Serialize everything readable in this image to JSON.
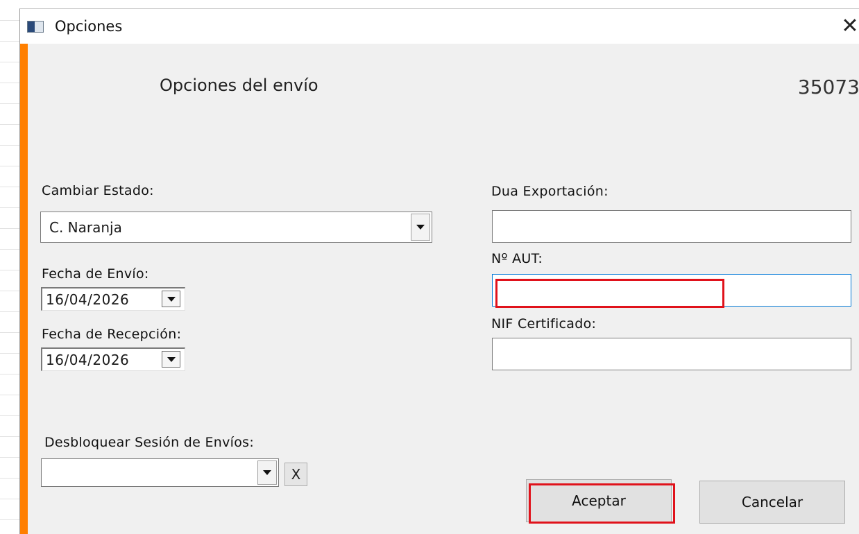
{
  "window": {
    "title": "Opciones",
    "close_glyph": "✕",
    "accent_color": "#ff7f00"
  },
  "header": {
    "section_title": "Opciones del envío",
    "record_number": "35073"
  },
  "left": {
    "status": {
      "label": "Cambiar Estado:",
      "value": "C. Naranja"
    },
    "send_date": {
      "label": "Fecha de Envío:",
      "value": "16/04/2026"
    },
    "receive_date": {
      "label": "Fecha de Recepción:",
      "value": "16/04/2026"
    },
    "unlock_session": {
      "label": "Desbloquear Sesión de Envíos:",
      "value": "",
      "clear_label": "X"
    }
  },
  "right": {
    "dua": {
      "label": "Dua Exportación:",
      "value": ""
    },
    "aut": {
      "label": "Nº AUT:",
      "value": ""
    },
    "nif": {
      "label": "NIF Certificado:",
      "value": ""
    }
  },
  "buttons": {
    "accept": "Aceptar",
    "cancel": "Cancelar"
  },
  "highlight_color": "#e0121b"
}
